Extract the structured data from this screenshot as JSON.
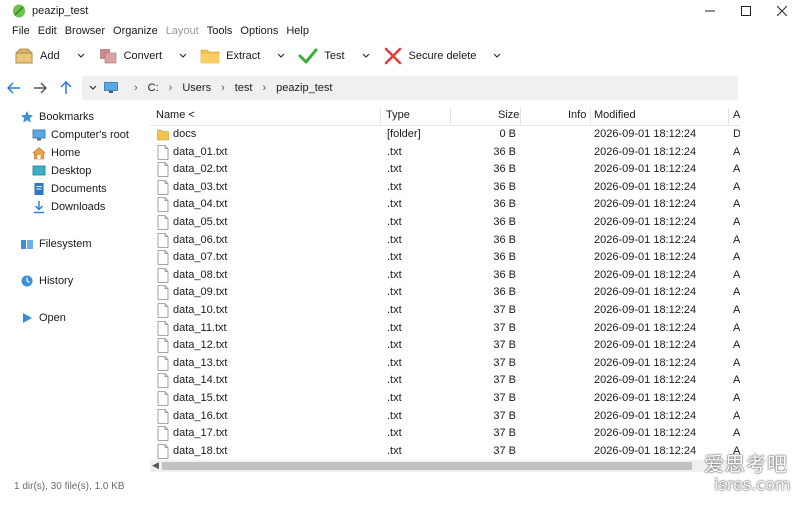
{
  "window": {
    "title": "peazip_test",
    "icons": {
      "app": "peazip-leaf-icon",
      "minimize": "minimize-icon",
      "maximize": "maximize-icon",
      "close": "close-icon"
    },
    "accent": "#3a8fd8"
  },
  "menu": [
    {
      "label": "File",
      "enabled": true
    },
    {
      "label": "Edit",
      "enabled": true
    },
    {
      "label": "Browser",
      "enabled": true
    },
    {
      "label": "Organize",
      "enabled": true
    },
    {
      "label": "Layout",
      "enabled": false
    },
    {
      "label": "Tools",
      "enabled": true
    },
    {
      "label": "Options",
      "enabled": true
    },
    {
      "label": "Help",
      "enabled": true
    }
  ],
  "toolbar": [
    {
      "label": "Add",
      "icon": "add-archive-icon"
    },
    {
      "label": "Convert",
      "icon": "convert-icon"
    },
    {
      "label": "Extract",
      "icon": "extract-folder-icon"
    },
    {
      "label": "Test",
      "icon": "test-check-icon"
    },
    {
      "label": "Secure delete",
      "icon": "secure-delete-x-icon"
    }
  ],
  "address": {
    "crumbs": [
      "C:",
      "Users",
      "test",
      "peazip_test"
    ],
    "root_icon": "computer-icon"
  },
  "sidebar": {
    "bookmarks_label": "Bookmarks",
    "bookmarks": [
      {
        "label": "Computer's root",
        "icon": "monitor-icon"
      },
      {
        "label": "Home",
        "icon": "home-icon"
      },
      {
        "label": "Desktop",
        "icon": "desktop-icon"
      },
      {
        "label": "Documents",
        "icon": "documents-icon"
      },
      {
        "label": "Downloads",
        "icon": "downloads-icon"
      }
    ],
    "filesystem_label": "Filesystem",
    "history_label": "History",
    "open_label": "Open"
  },
  "columns": {
    "name": "Name <",
    "type": "Type",
    "size": "Size",
    "info": "Info",
    "modified": "Modified",
    "attr": "A"
  },
  "files": [
    {
      "name": "docs",
      "type": "[folder]",
      "size": "0 B",
      "modified": "2026-09-01 18:12:24",
      "attr": "D",
      "kind": "folder"
    },
    {
      "name": "data_01.txt",
      "type": ".txt",
      "size": "36 B",
      "modified": "2026-09-01 18:12:24",
      "attr": "A",
      "kind": "file"
    },
    {
      "name": "data_02.txt",
      "type": ".txt",
      "size": "36 B",
      "modified": "2026-09-01 18:12:24",
      "attr": "A",
      "kind": "file"
    },
    {
      "name": "data_03.txt",
      "type": ".txt",
      "size": "36 B",
      "modified": "2026-09-01 18:12:24",
      "attr": "A",
      "kind": "file"
    },
    {
      "name": "data_04.txt",
      "type": ".txt",
      "size": "36 B",
      "modified": "2026-09-01 18:12:24",
      "attr": "A",
      "kind": "file"
    },
    {
      "name": "data_05.txt",
      "type": ".txt",
      "size": "36 B",
      "modified": "2026-09-01 18:12:24",
      "attr": "A",
      "kind": "file"
    },
    {
      "name": "data_06.txt",
      "type": ".txt",
      "size": "36 B",
      "modified": "2026-09-01 18:12:24",
      "attr": "A",
      "kind": "file"
    },
    {
      "name": "data_07.txt",
      "type": ".txt",
      "size": "36 B",
      "modified": "2026-09-01 18:12:24",
      "attr": "A",
      "kind": "file"
    },
    {
      "name": "data_08.txt",
      "type": ".txt",
      "size": "36 B",
      "modified": "2026-09-01 18:12:24",
      "attr": "A",
      "kind": "file"
    },
    {
      "name": "data_09.txt",
      "type": ".txt",
      "size": "36 B",
      "modified": "2026-09-01 18:12:24",
      "attr": "A",
      "kind": "file"
    },
    {
      "name": "data_10.txt",
      "type": ".txt",
      "size": "37 B",
      "modified": "2026-09-01 18:12:24",
      "attr": "A",
      "kind": "file"
    },
    {
      "name": "data_11.txt",
      "type": ".txt",
      "size": "37 B",
      "modified": "2026-09-01 18:12:24",
      "attr": "A",
      "kind": "file"
    },
    {
      "name": "data_12.txt",
      "type": ".txt",
      "size": "37 B",
      "modified": "2026-09-01 18:12:24",
      "attr": "A",
      "kind": "file"
    },
    {
      "name": "data_13.txt",
      "type": ".txt",
      "size": "37 B",
      "modified": "2026-09-01 18:12:24",
      "attr": "A",
      "kind": "file"
    },
    {
      "name": "data_14.txt",
      "type": ".txt",
      "size": "37 B",
      "modified": "2026-09-01 18:12:24",
      "attr": "A",
      "kind": "file"
    },
    {
      "name": "data_15.txt",
      "type": ".txt",
      "size": "37 B",
      "modified": "2026-09-01 18:12:24",
      "attr": "A",
      "kind": "file"
    },
    {
      "name": "data_16.txt",
      "type": ".txt",
      "size": "37 B",
      "modified": "2026-09-01 18:12:24",
      "attr": "A",
      "kind": "file"
    },
    {
      "name": "data_17.txt",
      "type": ".txt",
      "size": "37 B",
      "modified": "2026-09-01 18:12:24",
      "attr": "A",
      "kind": "file"
    },
    {
      "name": "data_18.txt",
      "type": ".txt",
      "size": "37 B",
      "modified": "2026-09-01 18:12:24",
      "attr": "A",
      "kind": "file"
    }
  ],
  "status": "1 dir(s), 30 file(s), 1.0 KB",
  "watermark": {
    "line1": "爱思考吧",
    "line2": "isres.com"
  }
}
